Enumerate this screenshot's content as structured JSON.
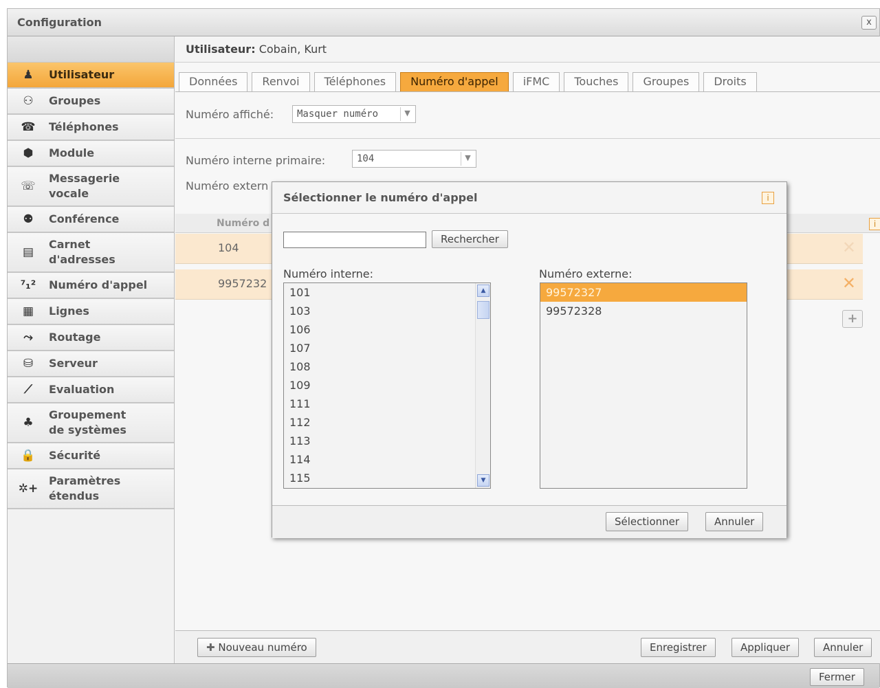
{
  "window": {
    "title": "Configuration",
    "close_label": "x"
  },
  "sidebar": {
    "items": [
      {
        "label": "Utilisateur",
        "icon": "user-icon",
        "glyph": "♟",
        "active": true
      },
      {
        "label": "Groupes",
        "icon": "group-icon",
        "glyph": "⚇"
      },
      {
        "label": "Téléphones",
        "icon": "phone-icon",
        "glyph": "☎"
      },
      {
        "label": "Module",
        "icon": "module-icon",
        "glyph": "⬢"
      },
      {
        "label": "Messagerie\nvocale",
        "icon": "voicemail-icon",
        "glyph": "☏"
      },
      {
        "label": "Conférence",
        "icon": "conference-icon",
        "glyph": "⚉"
      },
      {
        "label": "Carnet\nd'adresses",
        "icon": "addressbook-icon",
        "glyph": "▤"
      },
      {
        "label": "Numéro d'appel",
        "icon": "call-number-icon",
        "glyph": "⁷₁²"
      },
      {
        "label": "Lignes",
        "icon": "lines-icon",
        "glyph": "▦"
      },
      {
        "label": "Routage",
        "icon": "routing-icon",
        "glyph": "⤳"
      },
      {
        "label": "Serveur",
        "icon": "server-icon",
        "glyph": "⛁"
      },
      {
        "label": "Evaluation",
        "icon": "evaluation-icon",
        "glyph": "⟋"
      },
      {
        "label": "Groupement\nde systèmes",
        "icon": "system-group-icon",
        "glyph": "♣"
      },
      {
        "label": "Sécurité",
        "icon": "lock-icon",
        "glyph": "🔒"
      },
      {
        "label": "Paramètres\nétendus",
        "icon": "extended-settings-icon",
        "glyph": "✲+"
      }
    ]
  },
  "content": {
    "user_label": "Utilisateur:",
    "user_value": "Cobain, Kurt",
    "tabs": [
      {
        "label": "Données"
      },
      {
        "label": "Renvoi"
      },
      {
        "label": "Téléphones"
      },
      {
        "label": "Numéro d'appel",
        "active": true
      },
      {
        "label": "iFMC"
      },
      {
        "label": "Touches"
      },
      {
        "label": "Groupes"
      },
      {
        "label": "Droits"
      }
    ],
    "displayed_number_label": "Numéro affiché:",
    "displayed_number_value": "Masquer numéro",
    "primary_internal_label": "Numéro interne primaire:",
    "primary_internal_value": "104",
    "primary_external_label": "Numéro extern",
    "table_header": "Numéro d",
    "rows": [
      {
        "value": "104"
      },
      {
        "value": "9957232"
      }
    ],
    "info_glyph": "i",
    "add_glyph": "+",
    "delete_glyph": "✕",
    "new_number_button": "Nouveau numéro",
    "save_button": "Enregistrer",
    "apply_button": "Appliquer",
    "cancel_button": "Annuler"
  },
  "footer": {
    "close_button": "Fermer"
  },
  "dialog": {
    "title": "Sélectionner le numéro d'appel",
    "info_glyph": "i",
    "search_value": "",
    "search_button": "Rechercher",
    "internal_label": "Numéro interne:",
    "external_label": "Numéro externe:",
    "internal_numbers": [
      "101",
      "103",
      "106",
      "107",
      "108",
      "109",
      "111",
      "112",
      "113",
      "114",
      "115"
    ],
    "external_numbers": [
      "99572327",
      "99572328"
    ],
    "selected_external": "99572327",
    "select_button": "Sélectionner",
    "cancel_button": "Annuler"
  }
}
